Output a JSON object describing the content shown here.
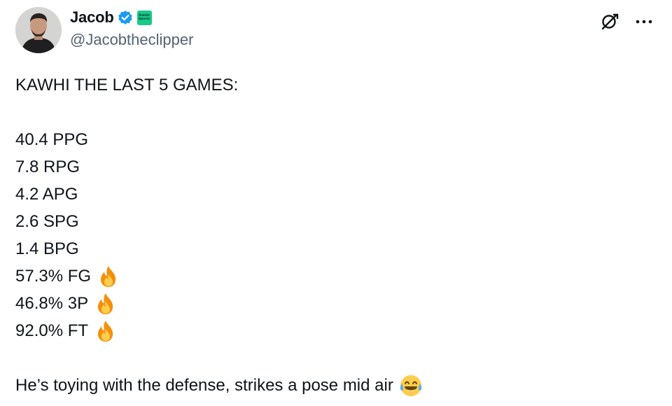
{
  "author": {
    "display_name": "Jacob",
    "handle": "@Jacobtheclipper",
    "verified_icon": "verified-badge-icon",
    "affiliate_badge": "Kalshi Sports",
    "avatar_icon": "user-avatar"
  },
  "header_actions": {
    "grok_icon": "grok-icon",
    "more_icon": "more-options-icon"
  },
  "tweet": {
    "heading": "KAWHI THE LAST 5 GAMES:",
    "stats": [
      {
        "text": "40.4 PPG",
        "emoji": ""
      },
      {
        "text": "7.8 RPG",
        "emoji": ""
      },
      {
        "text": "4.2 APG",
        "emoji": ""
      },
      {
        "text": "2.6 SPG",
        "emoji": ""
      },
      {
        "text": "1.4 BPG",
        "emoji": ""
      },
      {
        "text": "57.3% FG",
        "emoji": "fire-emoji"
      },
      {
        "text": "46.8% 3P",
        "emoji": "fire-emoji"
      },
      {
        "text": "92.0% FT",
        "emoji": "fire-emoji"
      }
    ],
    "closing": "He’s toying with the defense, strikes a pose mid air",
    "closing_emoji": "tears-of-joy-emoji"
  },
  "colors": {
    "text": "#0f1419",
    "secondary_text": "#536471",
    "verified_blue": "#1d9bf0",
    "kalshi_green": "#18c98a"
  }
}
